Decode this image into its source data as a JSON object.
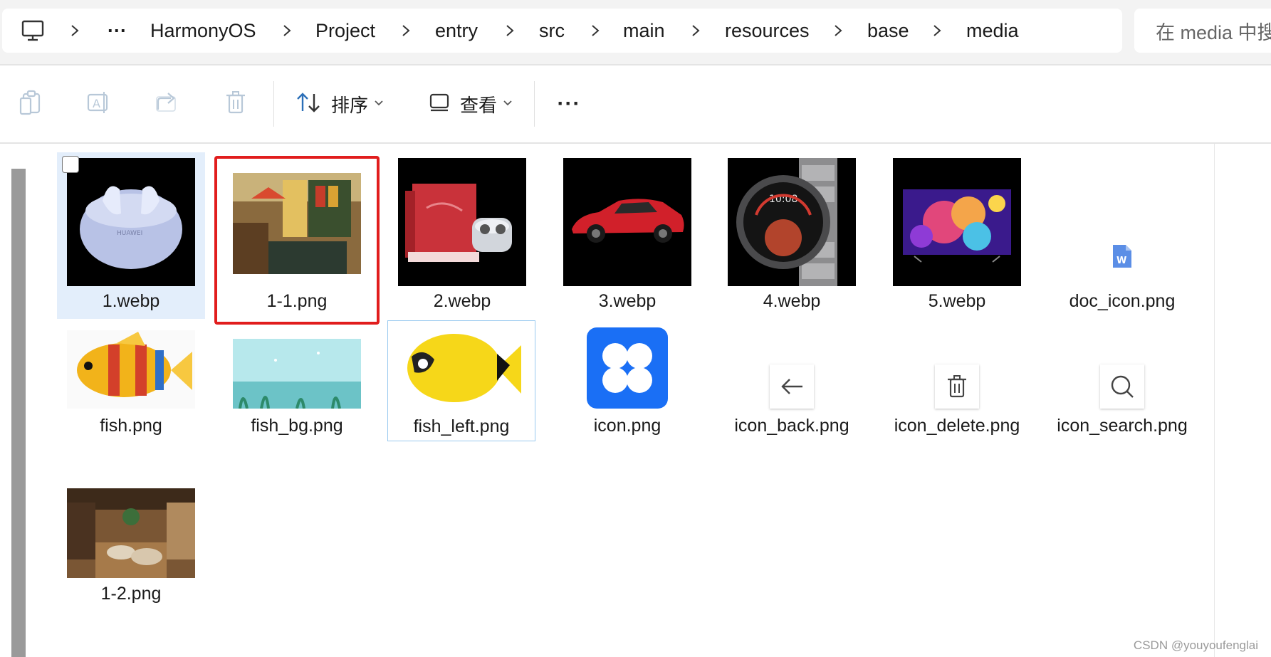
{
  "breadcrumb": {
    "items": [
      "HarmonyOS",
      "Project",
      "entry",
      "src",
      "main",
      "resources",
      "base",
      "media"
    ],
    "overflow": "···"
  },
  "search": {
    "placeholder": "在 media 中搜"
  },
  "toolbar": {
    "sort_label": "排序",
    "view_label": "查看",
    "more": "···"
  },
  "files": [
    {
      "name": "1.webp",
      "thumb": "earbuds-case"
    },
    {
      "name": "1-1.png",
      "thumb": "restaurant-interior"
    },
    {
      "name": "2.webp",
      "thumb": "red-box-earbuds"
    },
    {
      "name": "3.webp",
      "thumb": "red-car"
    },
    {
      "name": "4.webp",
      "thumb": "smartwatch"
    },
    {
      "name": "5.webp",
      "thumb": "tv-screen"
    },
    {
      "name": "doc_icon.png",
      "thumb": "doc-icon"
    },
    {
      "name": "fish.png",
      "thumb": "striped-fish"
    },
    {
      "name": "fish_bg.png",
      "thumb": "underwater-scene"
    },
    {
      "name": "fish_left.png",
      "thumb": "yellow-fish"
    },
    {
      "name": "icon.png",
      "thumb": "blue-app-icon"
    },
    {
      "name": "icon_back.png",
      "thumb": "back-arrow-icon"
    },
    {
      "name": "icon_delete.png",
      "thumb": "trash-icon"
    },
    {
      "name": "icon_search.png",
      "thumb": "search-icon"
    },
    {
      "name": "1-2.png",
      "thumb": "restaurant-hall"
    }
  ],
  "watermark": "CSDN @youyoufenglai"
}
